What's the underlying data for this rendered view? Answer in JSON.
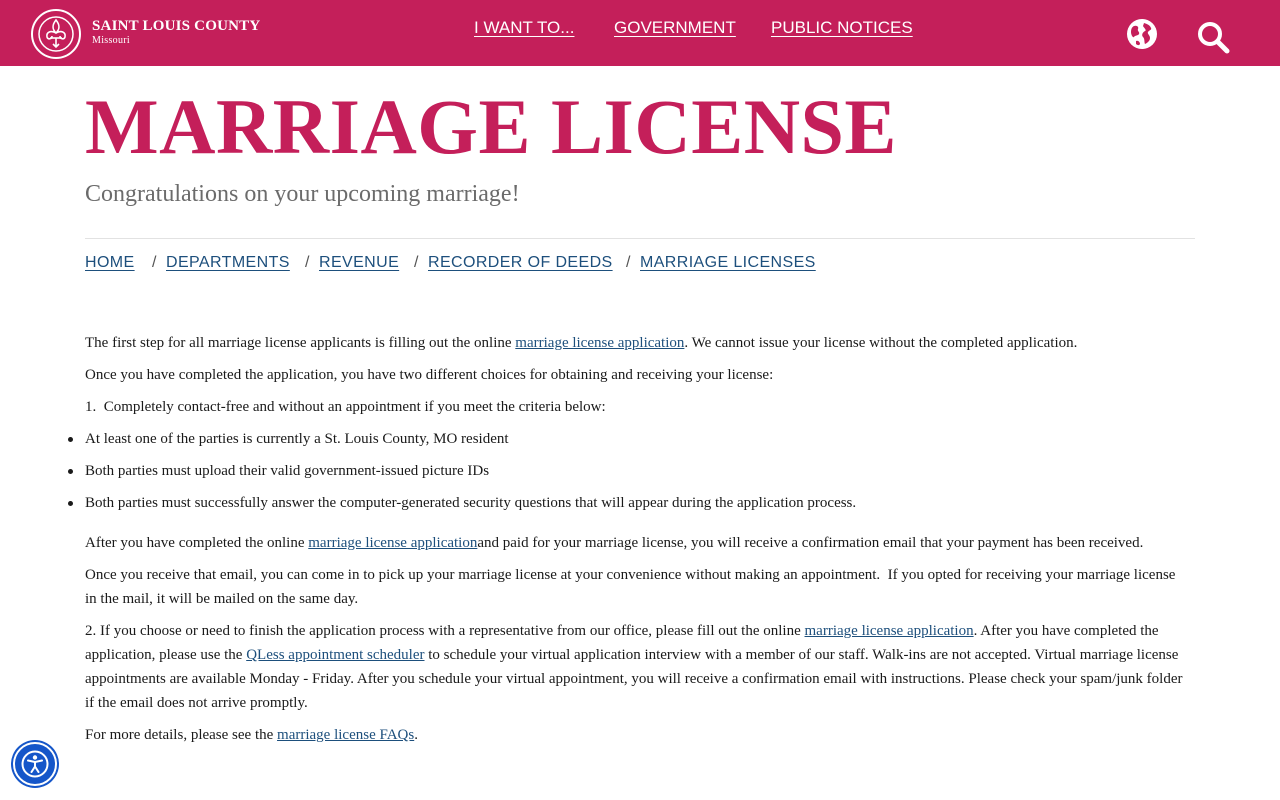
{
  "header": {
    "brand_name": "SAINT LOUIS COUNTY",
    "brand_sub": "Missouri",
    "nav": [
      "I WANT TO...",
      "GOVERNMENT",
      "PUBLIC NOTICES"
    ],
    "icons": [
      "fleur-de-lis-logo-icon",
      "globe-icon",
      "search-icon"
    ],
    "brand_color": "#c41f5a"
  },
  "page": {
    "title": "MARRIAGE LICENSE",
    "subtitle": "Congratulations on your upcoming marriage!"
  },
  "breadcrumb": [
    "HOME",
    "DEPARTMENTS",
    "REVENUE",
    "RECORDER OF DEEDS",
    "MARRIAGE LICENSES"
  ],
  "breadcrumb_separator": "/",
  "content": {
    "p1_a": "The first step for all marriage license applicants is filling out the online ",
    "p1_link": "marriage license application",
    "p1_b": ". We cannot issue your license without the completed application.",
    "p2": "Once you have completed the application, you have two different choices for obtaining and receiving your license:",
    "p3": "1.  Completely contact-free and without an appointment if you meet the criteria below:",
    "bullets": [
      "At least one of the parties is currently a St. Louis County, MO resident",
      "Both parties must upload their valid government-issued picture IDs",
      "Both parties must successfully answer the computer-generated security questions that will appear during the application process."
    ],
    "p4_a": "After you have completed the online ",
    "p4_link": "marriage license application",
    "p4_b": "and paid for your marriage license, you will receive a confirmation email that your payment has been received.",
    "p5": "Once you receive that email, you can come in to pick up your marriage license at your convenience without making an appointment.  If you opted for receiving your marriage license in the mail, it will be mailed on the same day.",
    "p6_a": "2. If you choose or need to finish the application process with a representative from our office, please fill out the online ",
    "p6_link1": "marriage license application",
    "p6_b": ". After you have completed the application, please use the ",
    "p6_link2": "QLess appointment scheduler",
    "p6_c": " to schedule your virtual application interview with a member of our staff. Walk-ins are not accepted. Virtual marriage license appointments are available Monday - Friday. After you schedule your virtual appointment, you will receive a confirmation email with instructions. Please check your spam/junk folder if the email does not arrive promptly.",
    "p7_a": "For more details, please see the ",
    "p7_link": "marriage license FAQs",
    "p7_b": "."
  },
  "accessibility": {
    "icon": "accessibility-icon",
    "color": "#1556c9"
  }
}
